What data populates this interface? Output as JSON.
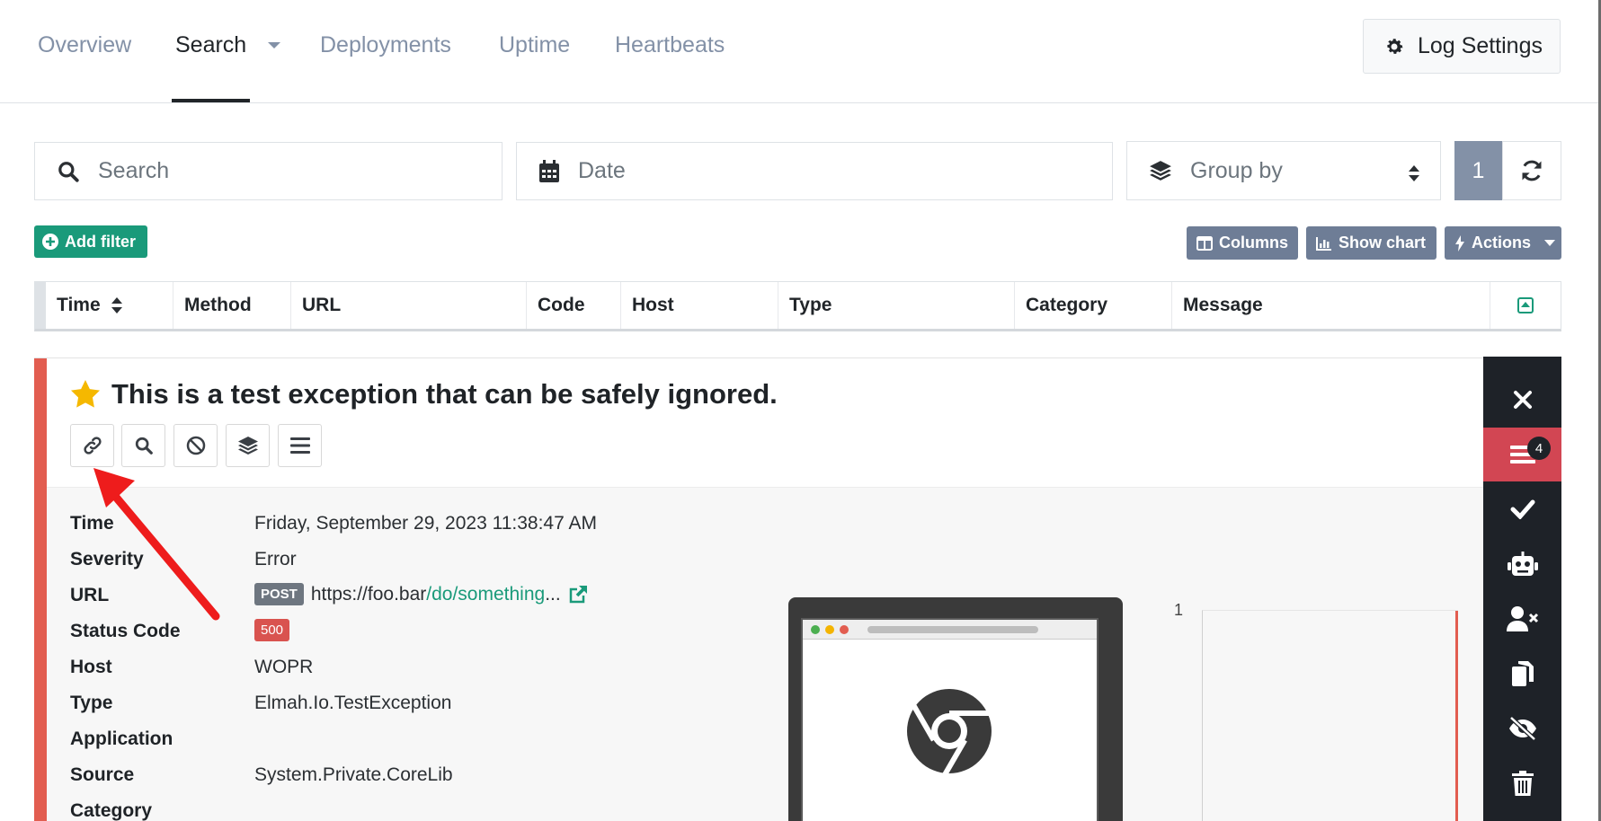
{
  "nav": {
    "tabs": [
      {
        "label": "Overview"
      },
      {
        "label": "Search"
      },
      {
        "label": "Deployments"
      },
      {
        "label": "Uptime"
      },
      {
        "label": "Heartbeats"
      }
    ],
    "active_tab": "Search",
    "log_settings_label": "Log Settings"
  },
  "search": {
    "search_placeholder": "Search",
    "date_placeholder": "Date",
    "group_by_label": "Group by",
    "page_number": "1"
  },
  "filters": {
    "add_filter_label": "Add filter",
    "columns_label": "Columns",
    "show_chart_label": "Show chart",
    "actions_label": "Actions"
  },
  "table": {
    "headers": [
      "Time",
      "Method",
      "URL",
      "Code",
      "Host",
      "Type",
      "Category",
      "Message"
    ]
  },
  "detail": {
    "title": "This is a test exception that can be safely ignored.",
    "fields": {
      "time_label": "Time",
      "time_value": "Friday, September 29, 2023 11:38:47 AM",
      "severity_label": "Severity",
      "severity_value": "Error",
      "url_label": "URL",
      "url_method": "POST",
      "url_base": "https://foo.bar",
      "url_path": "/do/something",
      "url_ellipsis": "...",
      "status_label": "Status Code",
      "status_value": "500",
      "host_label": "Host",
      "host_value": "WOPR",
      "type_label": "Type",
      "type_value": "Elmah.Io.TestException",
      "application_label": "Application",
      "source_label": "Source",
      "source_value": "System.Private.CoreLib",
      "category_label": "Category"
    },
    "chart_tick": "1"
  },
  "sidebar": {
    "messages_count": "4"
  },
  "colors": {
    "accent_teal": "#1a9a7a",
    "error_red": "#e25d50",
    "sidebar_dark": "#1e2228",
    "button_grey": "#6e7d96"
  }
}
